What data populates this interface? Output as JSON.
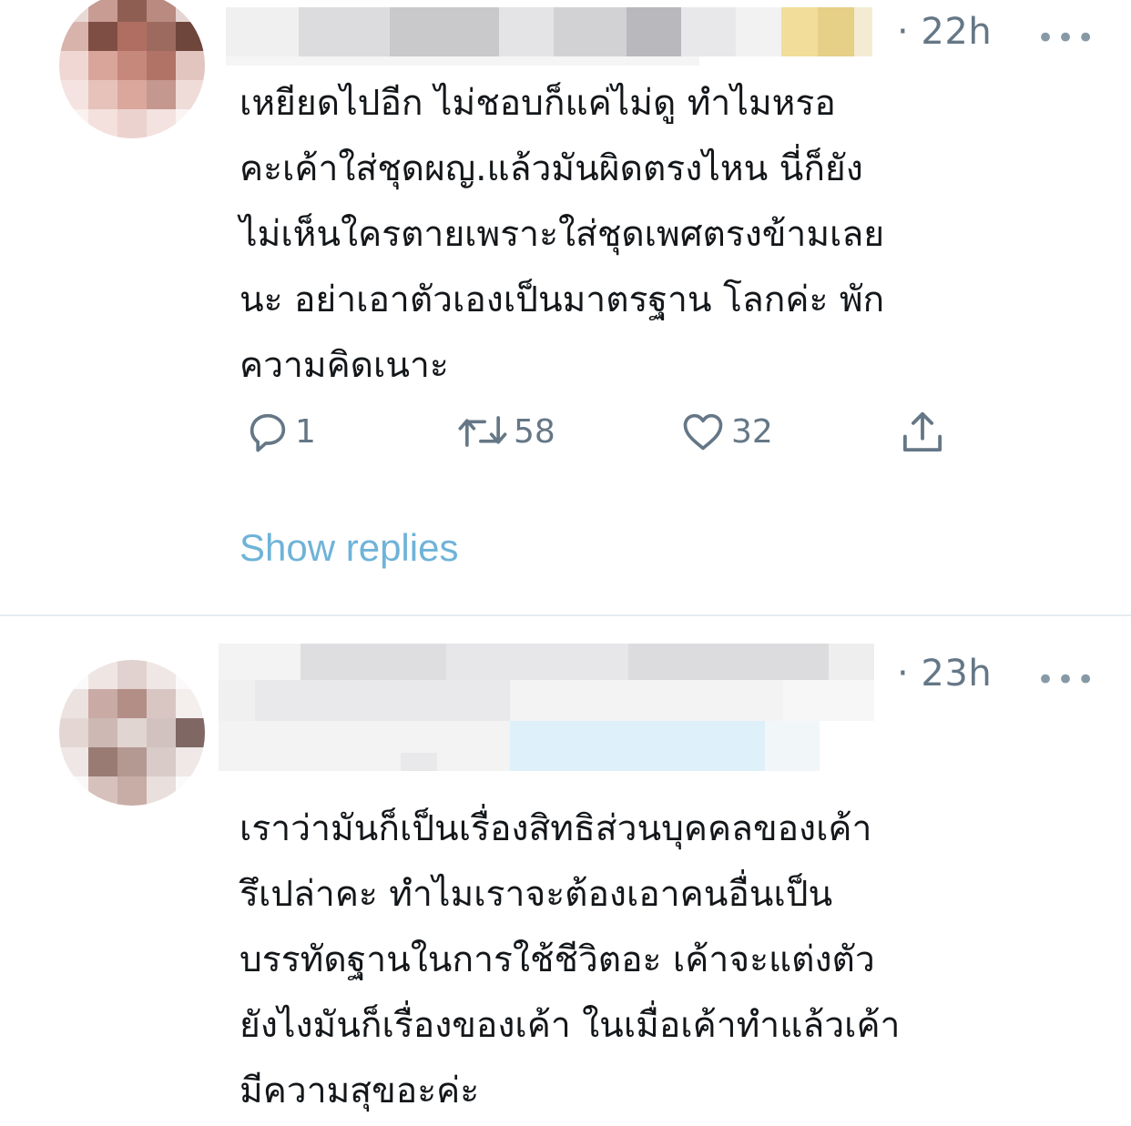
{
  "tweets": [
    {
      "time": "· 22h",
      "more_label": "•••",
      "body_lines": [
        "เหยียดไปอีก ไม่ชอบก็แค่ไม่ดู ทำไมหรอ",
        "คะเค้าใส่ชุดผญ.แล้วมันผิดตรงไหน นี่ก็ยัง",
        "ไม่เห็นใครตายเพราะใส่ชุดเพศตรงข้ามเลย",
        "นะ อย่าเอาตัวเองเป็นมาตรฐาน โลกค่ะ พัก",
        "ความคิดเนาะ"
      ],
      "actions": {
        "reply_icon": "reply-icon",
        "reply_count": "1",
        "retweet_icon": "retweet-icon",
        "retweet_count": "58",
        "like_icon": "heart-icon",
        "like_count": "32",
        "share_icon": "share-icon"
      },
      "show_replies": "Show replies"
    },
    {
      "time": "· 23h",
      "more_label": "•••",
      "body_lines": [
        "เราว่ามันก็เป็นเรื่องสิทธิส่วนบุคคลของเค้า",
        "รึเปล่าคะ ทำไมเราจะต้องเอาคนอื่นเป็น",
        "บรรทัดฐานในการใช้ชีวิตอะ เค้าจะแต่งตัว",
        "ยังไงมันก็เรื่องของเค้า ในเมื่อเค้าทำแล้วเค้า",
        "มีความสุขอะค่ะ"
      ]
    }
  ],
  "colors": {
    "text": "#14171a",
    "muted": "#657786",
    "link": "#6fb3d8",
    "divider": "#e6ecf0"
  }
}
